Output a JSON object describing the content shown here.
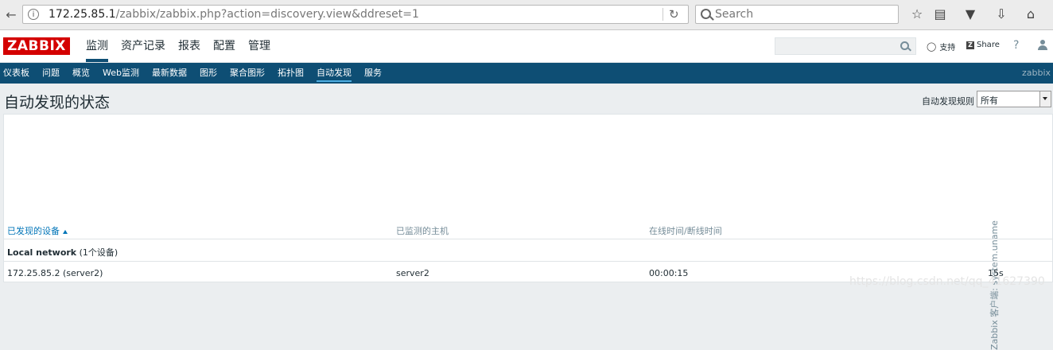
{
  "browser": {
    "back_icon": "back-arrow-icon",
    "url_host": "172.25.85.1",
    "url_path": "/zabbix/zabbix.php?action=discovery.view&ddreset=1",
    "search_placeholder": "Search"
  },
  "header": {
    "logo": "ZABBIX",
    "menu": [
      "监测",
      "资产记录",
      "报表",
      "配置",
      "管理"
    ],
    "active_menu": "监测",
    "support_label": "支持",
    "share_label": "Share",
    "help_label": "?"
  },
  "submenu": {
    "items": [
      "仪表板",
      "问题",
      "概览",
      "Web监测",
      "最新数据",
      "图形",
      "聚合图形",
      "拓扑图",
      "自动发现",
      "服务"
    ],
    "active": "自动发现",
    "server_label": "zabbix s"
  },
  "page": {
    "title": "自动发现的状态",
    "filter_label": "自动发现规则",
    "filter_value": "所有"
  },
  "table": {
    "columns": [
      "已发现的设备",
      "已监测的主机",
      "在线时间/断线时间"
    ],
    "vertical_column": "Zabbix 客户端: system.uname",
    "group_name": "Local network",
    "group_count": "(1个设备)",
    "rows": [
      {
        "device": "172.25.85.2 (server2)",
        "host": "server2",
        "uptime": "00:00:15",
        "value": "15s"
      }
    ]
  },
  "watermark": "https://blog.csdn.net/qq_41627390",
  "colors": {
    "brand": "#d40000",
    "nav": "#0e4e74",
    "link": "#0275b8"
  }
}
